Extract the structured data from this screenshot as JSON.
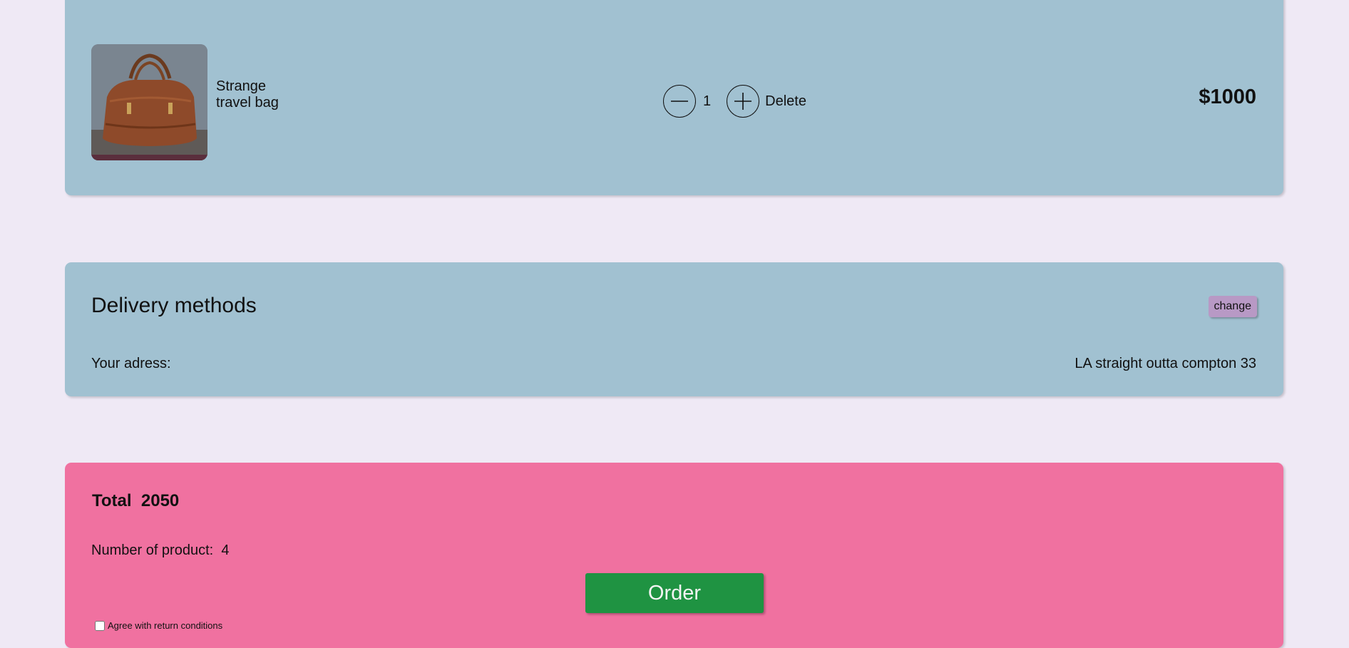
{
  "product": {
    "name": "Strange travel bag",
    "quantity": "1",
    "delete_label": "Delete",
    "price": "$1000",
    "image_icon": "leather-bag-photo"
  },
  "delivery": {
    "title": "Delivery methods",
    "change_label": "change",
    "address_label": "Your adress:",
    "address_value": "LA straight outta compton 33"
  },
  "summary": {
    "total_label": "Total",
    "total_value": "2050",
    "count_label": "Number of product:",
    "count_value": "4",
    "order_label": "Order",
    "agree_label": "Agree with return conditions",
    "agree_checked": false
  },
  "colors": {
    "page_background": "#efe9f5",
    "card_blue": "#a1c1d1",
    "card_pink": "#f071a0",
    "order_green": "#1f9342",
    "change_button": "#b899c5"
  }
}
